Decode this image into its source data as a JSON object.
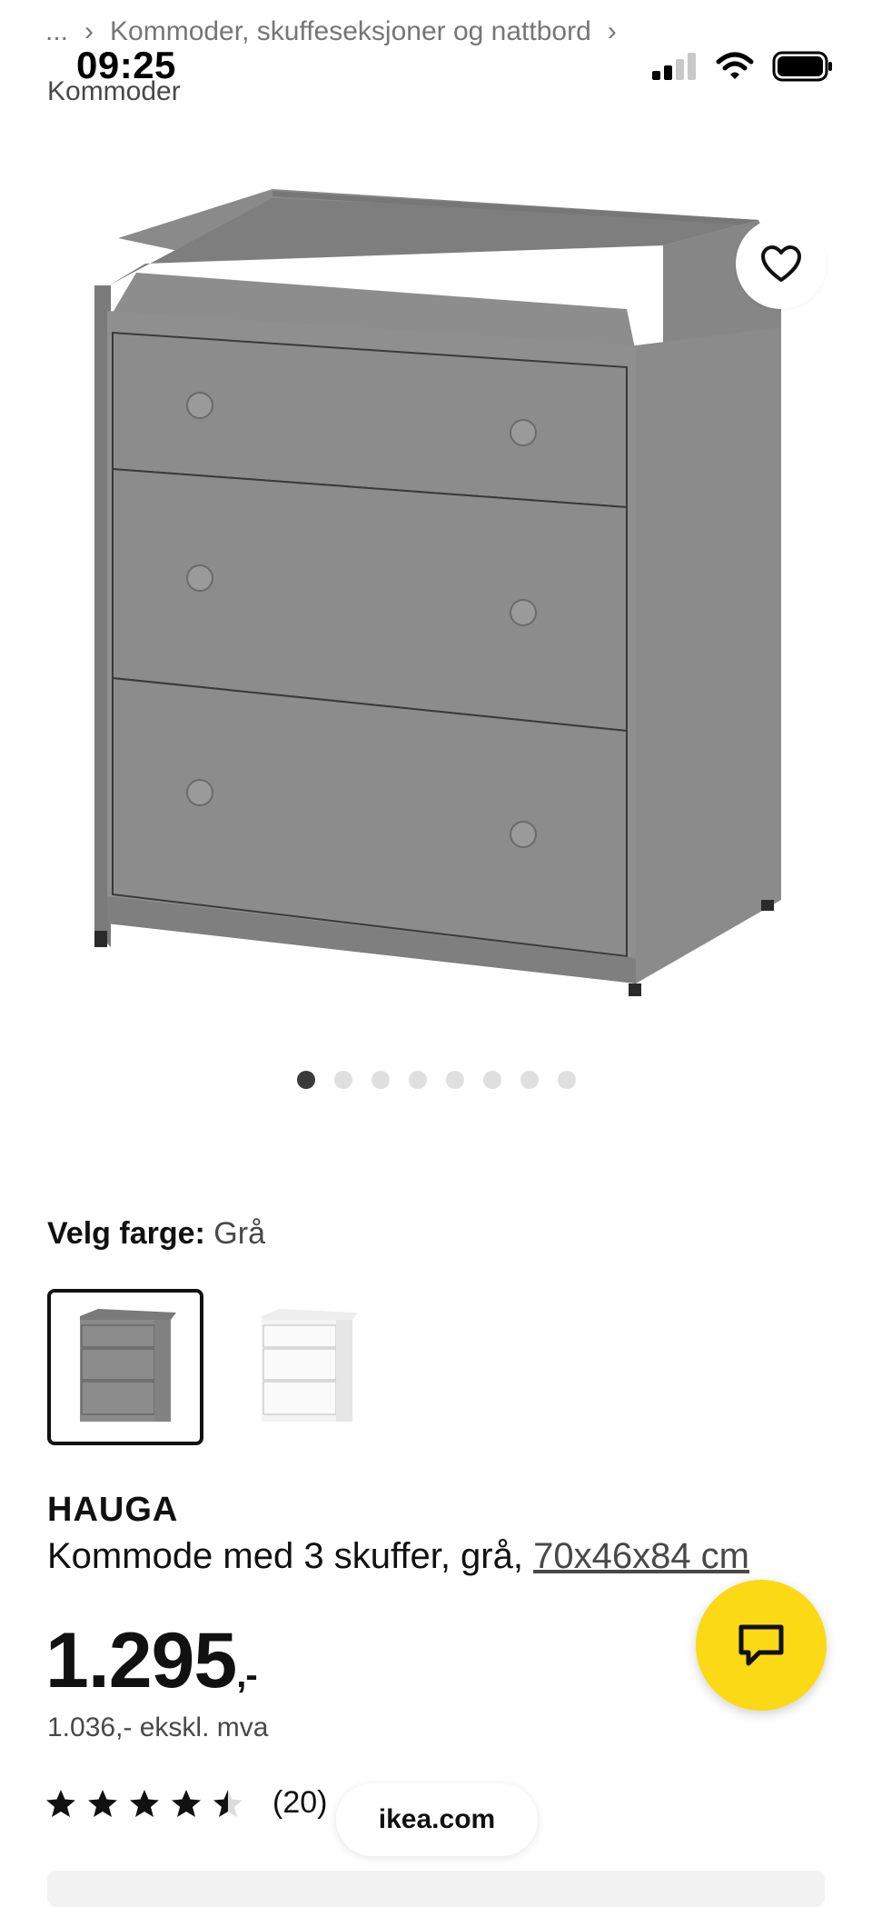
{
  "status_bar": {
    "time": "09:25"
  },
  "breadcrumb": {
    "ellipsis": "...",
    "parent": "Kommoder, skuffeseksjoner og nattbord",
    "current": "Kommoder"
  },
  "carousel": {
    "count": 8,
    "active_index": 0
  },
  "color_picker": {
    "label": "Velg farge:",
    "selected_value": "Grå",
    "swatches": [
      "grå",
      "hvit"
    ]
  },
  "product": {
    "name": "HAUGA",
    "description": "Kommode med 3 skuffer, grå,",
    "dimensions": "70x46x84 cm",
    "price_main": "1.295",
    "price_suffix": ",-",
    "price_excl_vat": "1.036,- ekskl. mva",
    "rating": 4.5,
    "rating_count": "(20)"
  },
  "browser": {
    "url": "ikea.com"
  },
  "colors": {
    "chat_accent": "#fbd914",
    "dresser_gray": "#8a8a8a"
  },
  "icons": [
    "heart-icon",
    "chat-icon",
    "signal-icon",
    "wifi-icon",
    "battery-icon",
    "star-icon"
  ]
}
